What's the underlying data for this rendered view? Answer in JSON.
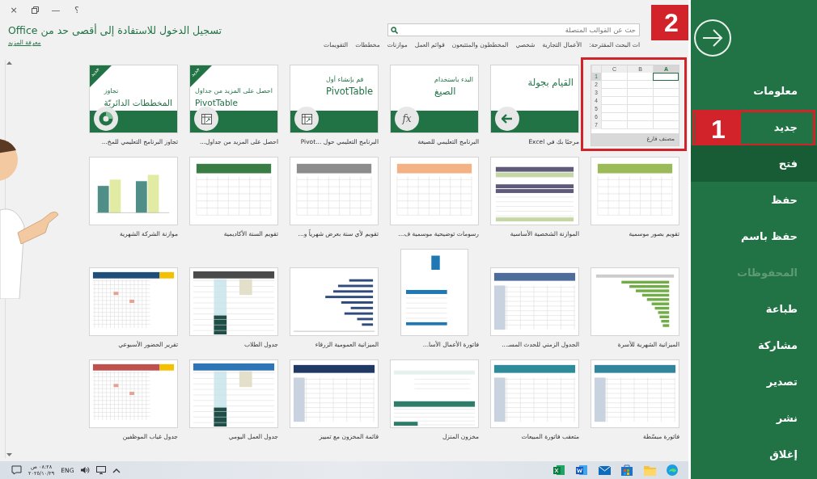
{
  "window": {
    "controls": [
      {
        "kind": "help",
        "label": "؟"
      },
      {
        "kind": "minimize",
        "label": "—"
      },
      {
        "kind": "restore"
      },
      {
        "kind": "close",
        "label": "×"
      }
    ]
  },
  "header": {
    "title": "تسجيل الدخول للاستفادة إلى أقصى حد من Office",
    "link": "معرفة المزيد",
    "search": {
      "placeholder": "حث عن القوالب المتصلة"
    },
    "annotation": "2",
    "suggestions_label": "ات البحث المقترحة:",
    "suggestions": [
      "الأعمال التجارية",
      "شخصي",
      "المخططون والمتتبعون",
      "قوائم العمل",
      "موازنات",
      "مخططات",
      "التقويمات"
    ]
  },
  "templates": [
    {
      "kind": "blank",
      "label": "مصنف فارغ",
      "columns": [
        "A",
        "B",
        "C"
      ],
      "rows": [
        "1",
        "2",
        "3",
        "4",
        "5",
        "6",
        "7"
      ],
      "outlined": true
    },
    {
      "kind": "feature",
      "big": "القيام بجولة",
      "label": "مرحبًا بك في Excel",
      "new": false
    },
    {
      "kind": "feature",
      "icon_text": "fx",
      "small": "البدء باستخدام",
      "big": "الصيغ",
      "label": "البرنامج التعليمي للصيغة",
      "new": false
    },
    {
      "kind": "feature",
      "small": "قم بإنشاء أول",
      "big": "PivotTable",
      "label": "البرنامج التعليمي حول ...Pivot",
      "new": false
    },
    {
      "kind": "feature",
      "small": "احصل على المزيد من جداول",
      "big": "PivotTable",
      "label": "احصل على المزيد من جداول...",
      "new": true,
      "badge": "جديد"
    },
    {
      "kind": "feature",
      "small": "تجاوز",
      "big": "المخططات الدائريّة",
      "label": "تجاوز البرنامج التعليمي للمخ...",
      "new": true,
      "badge": "جديد"
    },
    {
      "kind": "calendar",
      "color": "#9bbb59",
      "label": "تقويم بصور موسمية"
    },
    {
      "kind": "budget",
      "color": "#5f5a7a",
      "label": "الموازنة الشخصية الأساسية"
    },
    {
      "kind": "calendar",
      "color": "#f4b183",
      "label": "رسومات توضيحية موسمية ف..."
    },
    {
      "kind": "calendar",
      "color": "#8c8c8c",
      "label": "تقويم لأي سنة بعرض شهرياً و..."
    },
    {
      "kind": "calendar",
      "color": "#3a7d44",
      "label": "تقويم السنة الأكاديمية"
    },
    {
      "kind": "chart",
      "color": "#4f8f88",
      "label": "موازنة الشركة الشهرية"
    },
    {
      "kind": "hbars",
      "color": "#70ad47",
      "label": "الميزانية الشهرية للأسرة"
    },
    {
      "kind": "table",
      "color": "#4f6d9a",
      "label": "الجدول الزمني للحدث المسـ..."
    },
    {
      "kind": "invoice",
      "color": "#1f78b4",
      "label": "فاتورة الأعمال الأسا..."
    },
    {
      "kind": "gantt",
      "color": "#2f4b7c",
      "label": "الميزانية العمومية الزرقاء"
    },
    {
      "kind": "schedule",
      "color": "#4a4a4a",
      "label": "جدول الطلاب"
    },
    {
      "kind": "attendance",
      "color": "#1f4e79",
      "label": "تقرير الحضور الأسبوعي"
    },
    {
      "kind": "table",
      "color": "#31859c",
      "label": "فاتورة مبسّطة"
    },
    {
      "kind": "table",
      "color": "#2e8b9a",
      "label": "متعقب فاتورة المبيعات"
    },
    {
      "kind": "inventory",
      "color": "#2e7d6b",
      "label": "مخزون المنزل"
    },
    {
      "kind": "table",
      "color": "#1f3864",
      "label": "قائمة المخزون مع تمييز"
    },
    {
      "kind": "schedule",
      "color": "#2e75b6",
      "label": "جدول العمل اليومي"
    },
    {
      "kind": "attendance",
      "color": "#c0504d",
      "label": "جدول غياب الموظفين"
    }
  ],
  "sidebar": {
    "items": [
      {
        "label": "معلومات",
        "selected": false,
        "disabled": false
      },
      {
        "label": "جديد",
        "selected": false,
        "disabled": false,
        "annotation": "1"
      },
      {
        "label": "فتح",
        "selected": true,
        "disabled": false
      },
      {
        "label": "حفظ",
        "selected": false,
        "disabled": false
      },
      {
        "label": "حفظ باسم",
        "selected": false,
        "disabled": false
      },
      {
        "label": "المحفوظات",
        "selected": false,
        "disabled": true
      },
      {
        "label": "طباعة",
        "selected": false,
        "disabled": false
      },
      {
        "label": "مشاركة",
        "selected": false,
        "disabled": false
      },
      {
        "label": "تصدير",
        "selected": false,
        "disabled": false
      },
      {
        "label": "نشر",
        "selected": false,
        "disabled": false
      },
      {
        "label": "إغلاق",
        "selected": false,
        "disabled": false
      }
    ]
  },
  "taskbar": {
    "time": "٠٨:٢٨ ص",
    "date": "٢٠٢٥/١٠/٢٩",
    "language": "ENG",
    "apps": [
      {
        "kind": "excel"
      },
      {
        "kind": "word"
      },
      {
        "kind": "mail"
      },
      {
        "kind": "store"
      },
      {
        "kind": "folder"
      },
      {
        "kind": "edge"
      }
    ]
  }
}
